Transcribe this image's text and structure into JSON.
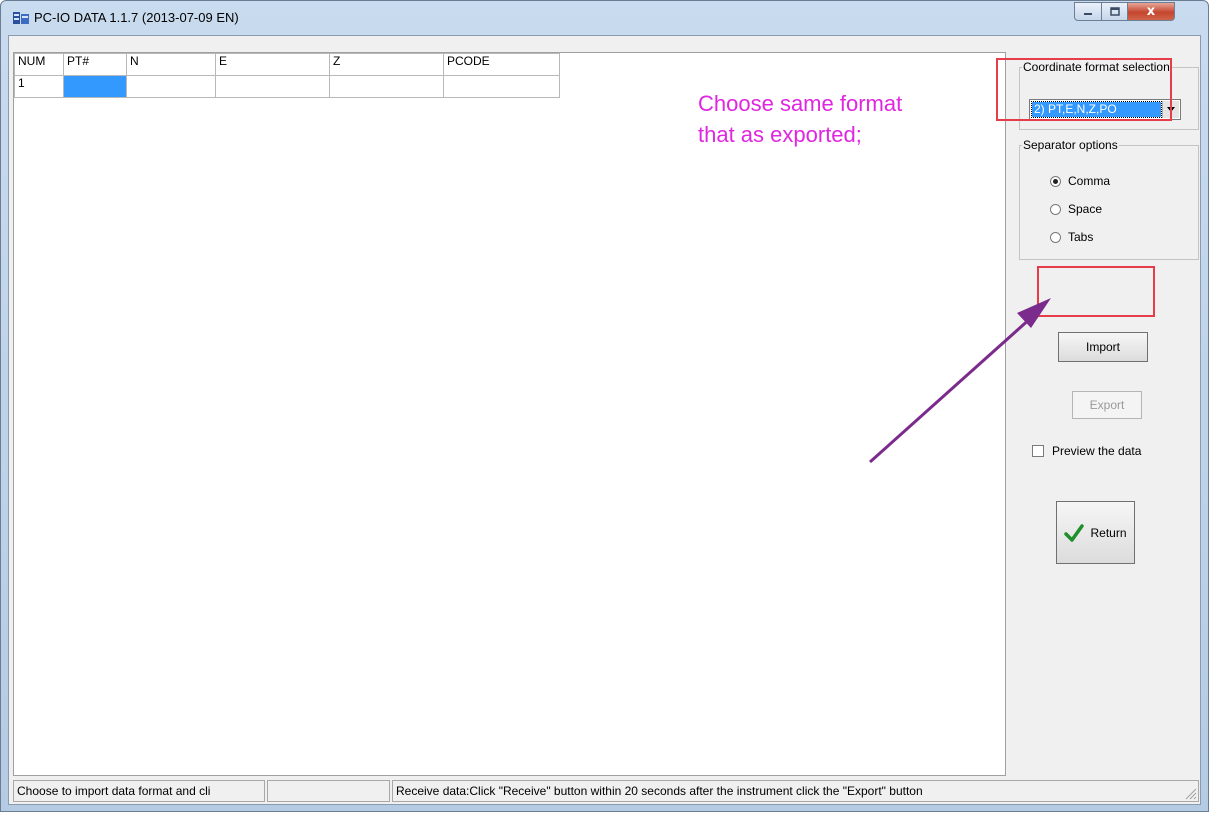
{
  "window": {
    "title": "PC-IO DATA 1.1.7 (2013-07-09 EN)",
    "close_glyph": "x"
  },
  "grid": {
    "columns": [
      "NUM",
      "PT#",
      "N",
      "E",
      "Z",
      "PCODE"
    ],
    "rows": [
      [
        "1",
        "",
        "",
        "",
        "",
        ""
      ]
    ]
  },
  "annotation": {
    "line1": "Choose same format",
    "line2": "that as exported;",
    "color": "#e026e0",
    "arrow_color": "#7b2b8c",
    "highlight_color": "#e53d4a"
  },
  "coordinate_format": {
    "label": "Coordinate format selection",
    "selected": "2) PT,E,N,Z,PO"
  },
  "separator": {
    "label": "Separator options",
    "options": [
      {
        "label": "Comma",
        "checked": true
      },
      {
        "label": "Space",
        "checked": false
      },
      {
        "label": "Tabs",
        "checked": false
      }
    ]
  },
  "buttons": {
    "import": "Import",
    "export": "Export",
    "return": "Return"
  },
  "preview": {
    "label": "Preview the data",
    "checked": false
  },
  "status": {
    "left": "Choose to import data format and cli",
    "middle": "",
    "right": "Receive data:Click \"Receive\" button within 20 seconds after the instrument click the \"Export\" button"
  }
}
